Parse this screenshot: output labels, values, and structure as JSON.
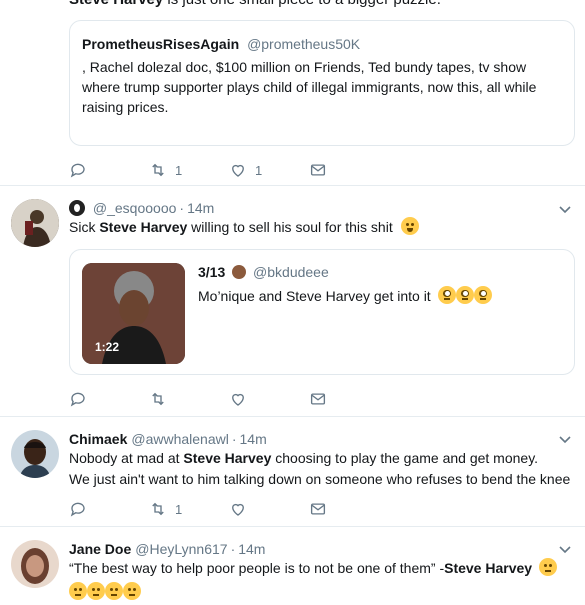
{
  "top_fragment": {
    "bold": "Steve Harvey",
    "rest": "is just one small piece to a bigger puzzle."
  },
  "tweet1": {
    "quote": {
      "name": "PrometheusRisesAgain",
      "handle": "@prometheus50K",
      "text": ", Rachel dolezal doc, $100 million on Friends, Ted bundy tapes, tv show where trump supporter plays child of illegal immigrants, now this, all while raising prices."
    },
    "actions": {
      "reply": "",
      "retweet": "1",
      "like": "1"
    }
  },
  "tweet2": {
    "name": "",
    "handle": "@_esqooooo",
    "time": "14m",
    "text_pre": "Sick ",
    "text_bold": "Steve Harvey",
    "text_post": " willing to sell his soul for this shit",
    "quote": {
      "name": "3/13",
      "handle": "@bkdudeee",
      "text": "Mo’nique and Steve Harvey get into it",
      "duration": "1:22"
    },
    "actions": {
      "reply": "",
      "retweet": "",
      "like": ""
    }
  },
  "tweet3": {
    "name": "Chimaek",
    "handle": "@awwhalenawl",
    "time": "14m",
    "line1_pre": "Nobody at mad at ",
    "line1_bold": "Steve Harvey",
    "line1_post": " choosing to play the game and get money.",
    "line2": "We just ain't want to him talking down on someone who refuses to bend the knee",
    "actions": {
      "reply": "",
      "retweet": "1",
      "like": ""
    }
  },
  "tweet4": {
    "name": "Jane Doe",
    "handle": "@HeyLynn617",
    "time": "14m",
    "text_pre": "“The best way to help poor people is to not be one of them” -",
    "text_bold": "Steve Harvey"
  },
  "icons": {
    "reply": "reply-icon",
    "retweet": "retweet-icon",
    "like": "heart-icon",
    "dm": "envelope-icon",
    "caret": "chevron-down-icon"
  },
  "colors": {
    "text": "#14171a",
    "muted": "#657786",
    "border": "#e1e8ed"
  }
}
